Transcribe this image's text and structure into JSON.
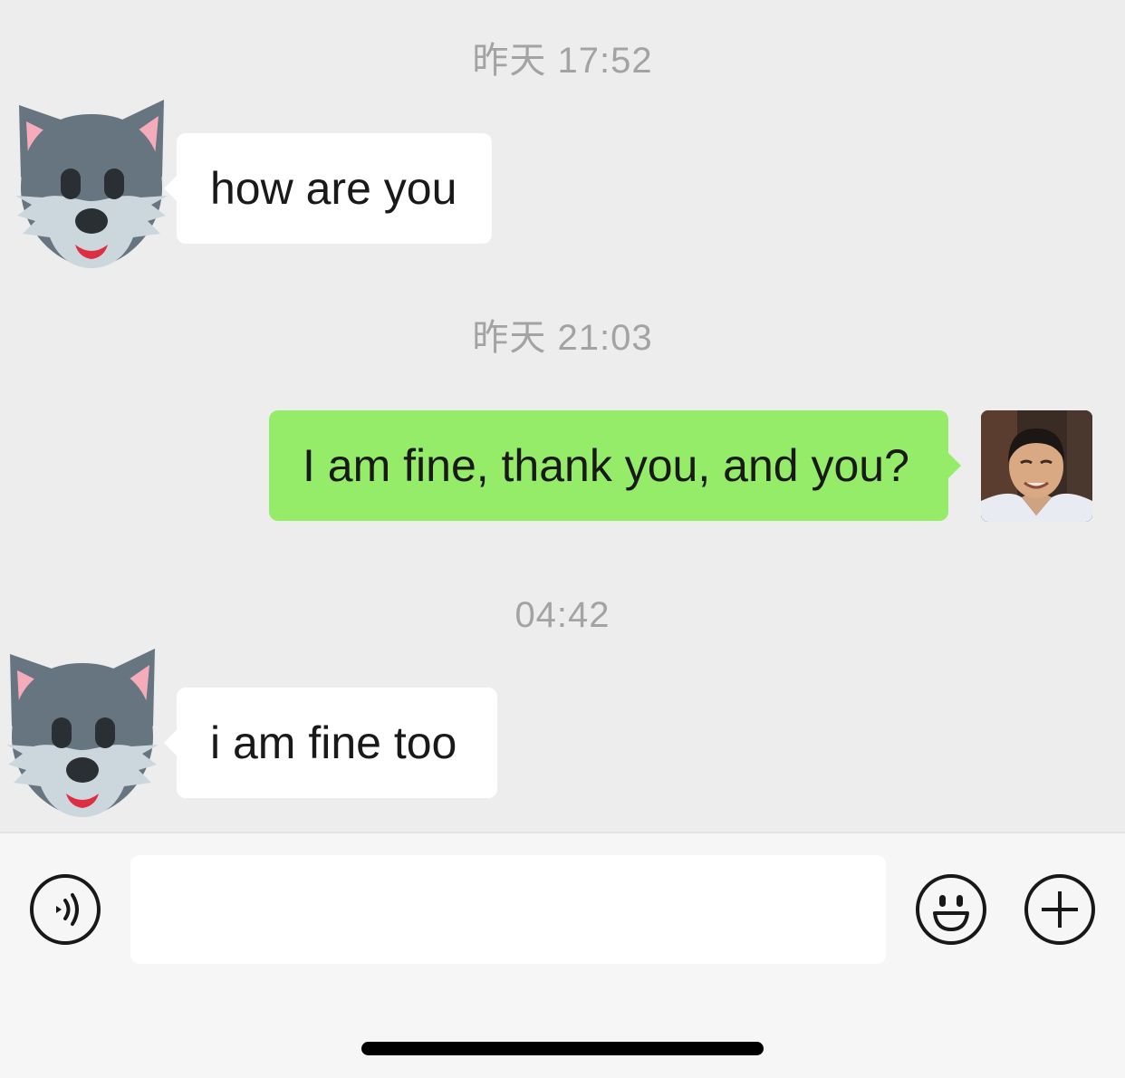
{
  "messages": [
    {
      "time": "昨天 17:52",
      "sender": "contact",
      "avatar": "wolf-face-icon",
      "text": "how are you"
    },
    {
      "time": "昨天 21:03",
      "sender": "me",
      "avatar": "user-photo",
      "text": "I am fine, thank you, and you?"
    },
    {
      "time": "04:42",
      "sender": "contact",
      "avatar": "wolf-face-icon",
      "text": "i am fine too"
    }
  ],
  "composer": {
    "input_value": "",
    "voice_icon": "voice-icon",
    "emoji_icon": "emoji-icon",
    "plus_icon": "plus-icon"
  },
  "colors": {
    "chat_background": "#ededed",
    "incoming_bubble": "#ffffff",
    "outgoing_bubble": "#95ec69",
    "timestamp_text": "#a3a3a3",
    "composer_background": "#f6f6f6"
  }
}
